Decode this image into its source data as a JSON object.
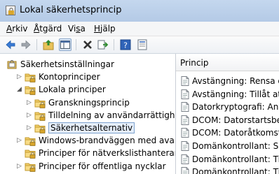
{
  "window": {
    "title": "Lokal säkerhetsprincip"
  },
  "menu": [
    {
      "label": "Arkiv",
      "key": "A"
    },
    {
      "label": "Åtgärd",
      "key": "Å"
    },
    {
      "label": "Visa",
      "key": "s"
    },
    {
      "label": "Hjälp",
      "key": "H"
    }
  ],
  "toolbar": {
    "buttons": [
      "back-icon",
      "forward-icon",
      "up-folder-icon",
      "show-hide-tree-icon",
      "delete-icon",
      "export-list-icon",
      "help-icon",
      "properties-icon"
    ]
  },
  "tree": {
    "items": [
      {
        "label": "Säkerhetsinställningar",
        "expander": "",
        "icon": "security-settings-icon",
        "level": 0
      },
      {
        "label": "Kontoprinciper",
        "expander": "▷",
        "icon": "folder-icon",
        "level": 1
      },
      {
        "label": "Lokala principer",
        "expander": "◢",
        "icon": "folder-icon",
        "level": 1
      },
      {
        "label": "Granskningsprincip",
        "expander": "▷",
        "icon": "folder-icon",
        "level": 2
      },
      {
        "label": "Tilldelning av användarrättigheter",
        "expander": "▷",
        "icon": "folder-icon",
        "level": 2
      },
      {
        "label": "Säkerhetsalternativ",
        "expander": "▷",
        "icon": "folder-icon",
        "level": 2,
        "selected": true
      },
      {
        "label": "Windows-brandväggen med avancerad säkerhet",
        "expander": "▷",
        "icon": "folder-icon",
        "level": 1
      },
      {
        "label": "Principer för nätverkslisthanteraren",
        "expander": "",
        "icon": "folder-icon",
        "level": 1
      },
      {
        "label": "Principer för offentliga nycklar",
        "expander": "▷",
        "icon": "folder-icon",
        "level": 1
      }
    ]
  },
  "list": {
    "header": "Princip",
    "rows": [
      "Avstängning: Rensa den virtuella minnesväxlingsfilen",
      "Avstängning: Tillåt att systemet stängs av utan inloggning",
      "Datorkryptografi: Använd FIPS-kompatibla algoritmer",
      "DCOM: Datorstartsbegränsningar",
      "DCOM: Datoråtkomstbegränsningar",
      "Domänkontrollant: Signeringskrav för LDAP-server",
      "Domänkontrollant: Tillåt serveroperatörer att schemalägga",
      "Domänkontrollant: Tillåt inte ändringar av datorkontolösenord"
    ]
  }
}
